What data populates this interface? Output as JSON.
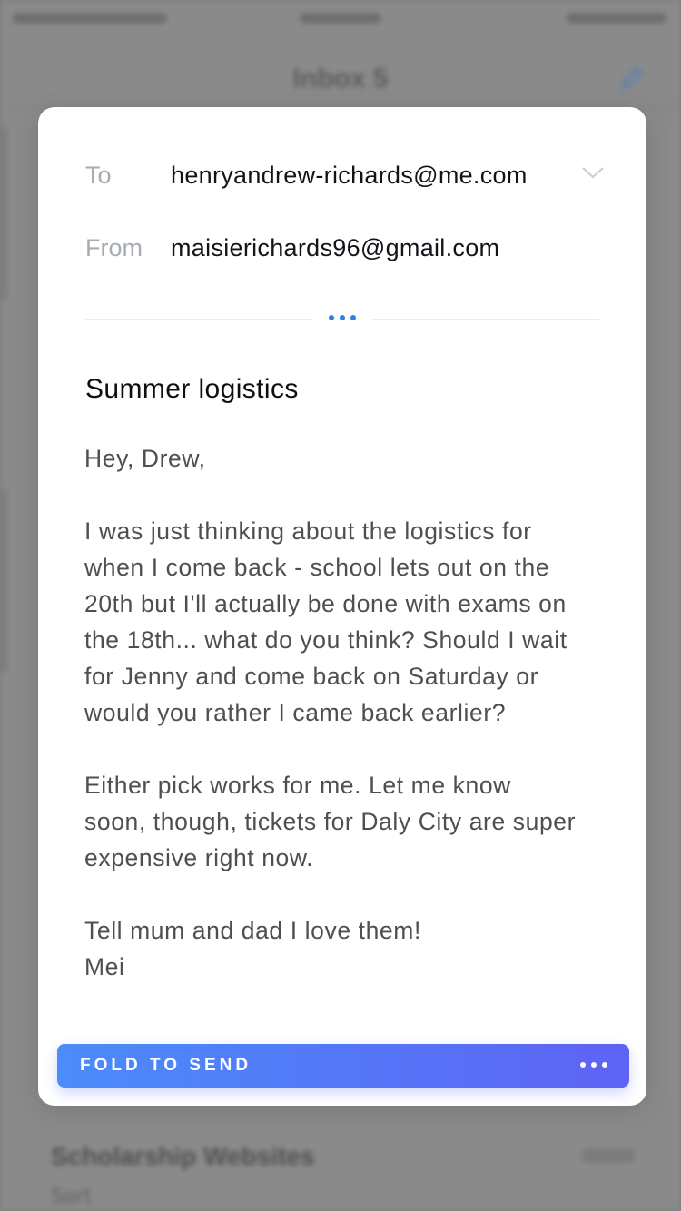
{
  "background": {
    "title": "Inbox 5",
    "row_title": "Scholarship Websites",
    "row_sub": "Sort"
  },
  "email": {
    "to_label": "To",
    "to_value": "henryandrew-richards@me.com",
    "from_label": "From",
    "from_value": "maisierichards96@gmail.com",
    "subject": "Summer logistics",
    "body_lines": [
      "Hey, Drew,",
      "I was just thinking about the logistics for",
      "when I come back - school lets out on the",
      "20th but I'll actually be done with exams on",
      "the 18th... what do you think? Should I wait",
      "for Jenny and come back on Saturday or",
      "would you rather I came back earlier?",
      "Either pick works for me. Let me know",
      "soon, though, tickets for Daly City are super",
      "expensive right now.",
      "Tell mum and dad I love them!",
      "Mei"
    ]
  },
  "send": {
    "label": "FOLD TO SEND"
  },
  "icons": {
    "recipient_dropdown": "chevron-down-icon",
    "header_more": "more-dots-icon",
    "send_more": "more-dots-icon",
    "compose": "compose-icon"
  },
  "colors": {
    "accent": "#2f7ee6",
    "send_gradient_start": "#4b8cfb",
    "send_gradient_end": "#5e63f4",
    "label_gray": "#a7acb2",
    "body_text": "#4d4f52"
  }
}
